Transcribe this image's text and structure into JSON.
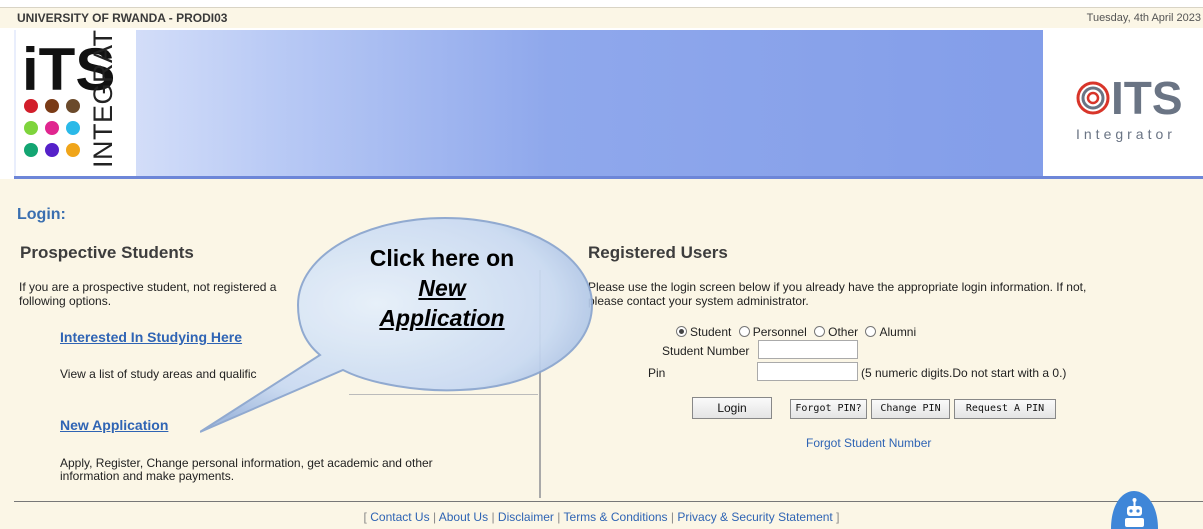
{
  "topbar": {
    "org": "UNIVERSITY OF RWANDA - PRODI03",
    "date": "Tuesday, 4th April 2023"
  },
  "logos": {
    "left": {
      "letters": "iTS",
      "word": "INTEGRATOR"
    },
    "right": {
      "letters": "ITS",
      "word": "Integrator"
    }
  },
  "login_title": "Login:",
  "prospective": {
    "title": "Prospective Students",
    "intro_line1": "If you are a prospective student, not registered a",
    "intro_line2": "following options.",
    "interested_link": "Interested In Studying Here",
    "interested_desc": "View a list of study areas and qualific",
    "new_app_link": "New Application",
    "new_app_desc_line1": "Apply, Register, Change personal information, get academic and other",
    "new_app_desc_line2": "information and make payments."
  },
  "registered": {
    "title": "Registered Users",
    "intro_line1": "Please use the login screen below if you already have the appropriate login information. If not,",
    "intro_line2": "please contact your system administrator.",
    "radios": [
      {
        "label": "Student",
        "selected": true
      },
      {
        "label": "Personnel",
        "selected": false
      },
      {
        "label": "Other",
        "selected": false
      },
      {
        "label": "Alumni",
        "selected": false
      }
    ],
    "student_number_label": "Student Number",
    "student_number_value": "",
    "pin_label": "Pin",
    "pin_value": "",
    "pin_hint": "(5 numeric digits.Do not start with a 0.)",
    "login_button": "Login",
    "forgot_pin_button": "Forgot PIN?",
    "change_pin_button": "Change PIN",
    "request_pin_button": "Request A PIN",
    "forgot_student_number_link": "Forgot Student Number"
  },
  "callout": {
    "line1": "Click here on",
    "line2": "New",
    "line3": "Application"
  },
  "footer": {
    "open": "[",
    "close": "]",
    "links": [
      "Contact Us",
      "About Us",
      "Disclaimer",
      "Terms & Conditions",
      "Privacy & Security Statement"
    ]
  },
  "colors": {
    "link": "#2f64b4",
    "banner": "#7f9ae8",
    "page_bg": "#fbf6e6"
  },
  "icons": [
    "robot-chat-icon",
    "its-logo-left",
    "its-logo-right"
  ]
}
